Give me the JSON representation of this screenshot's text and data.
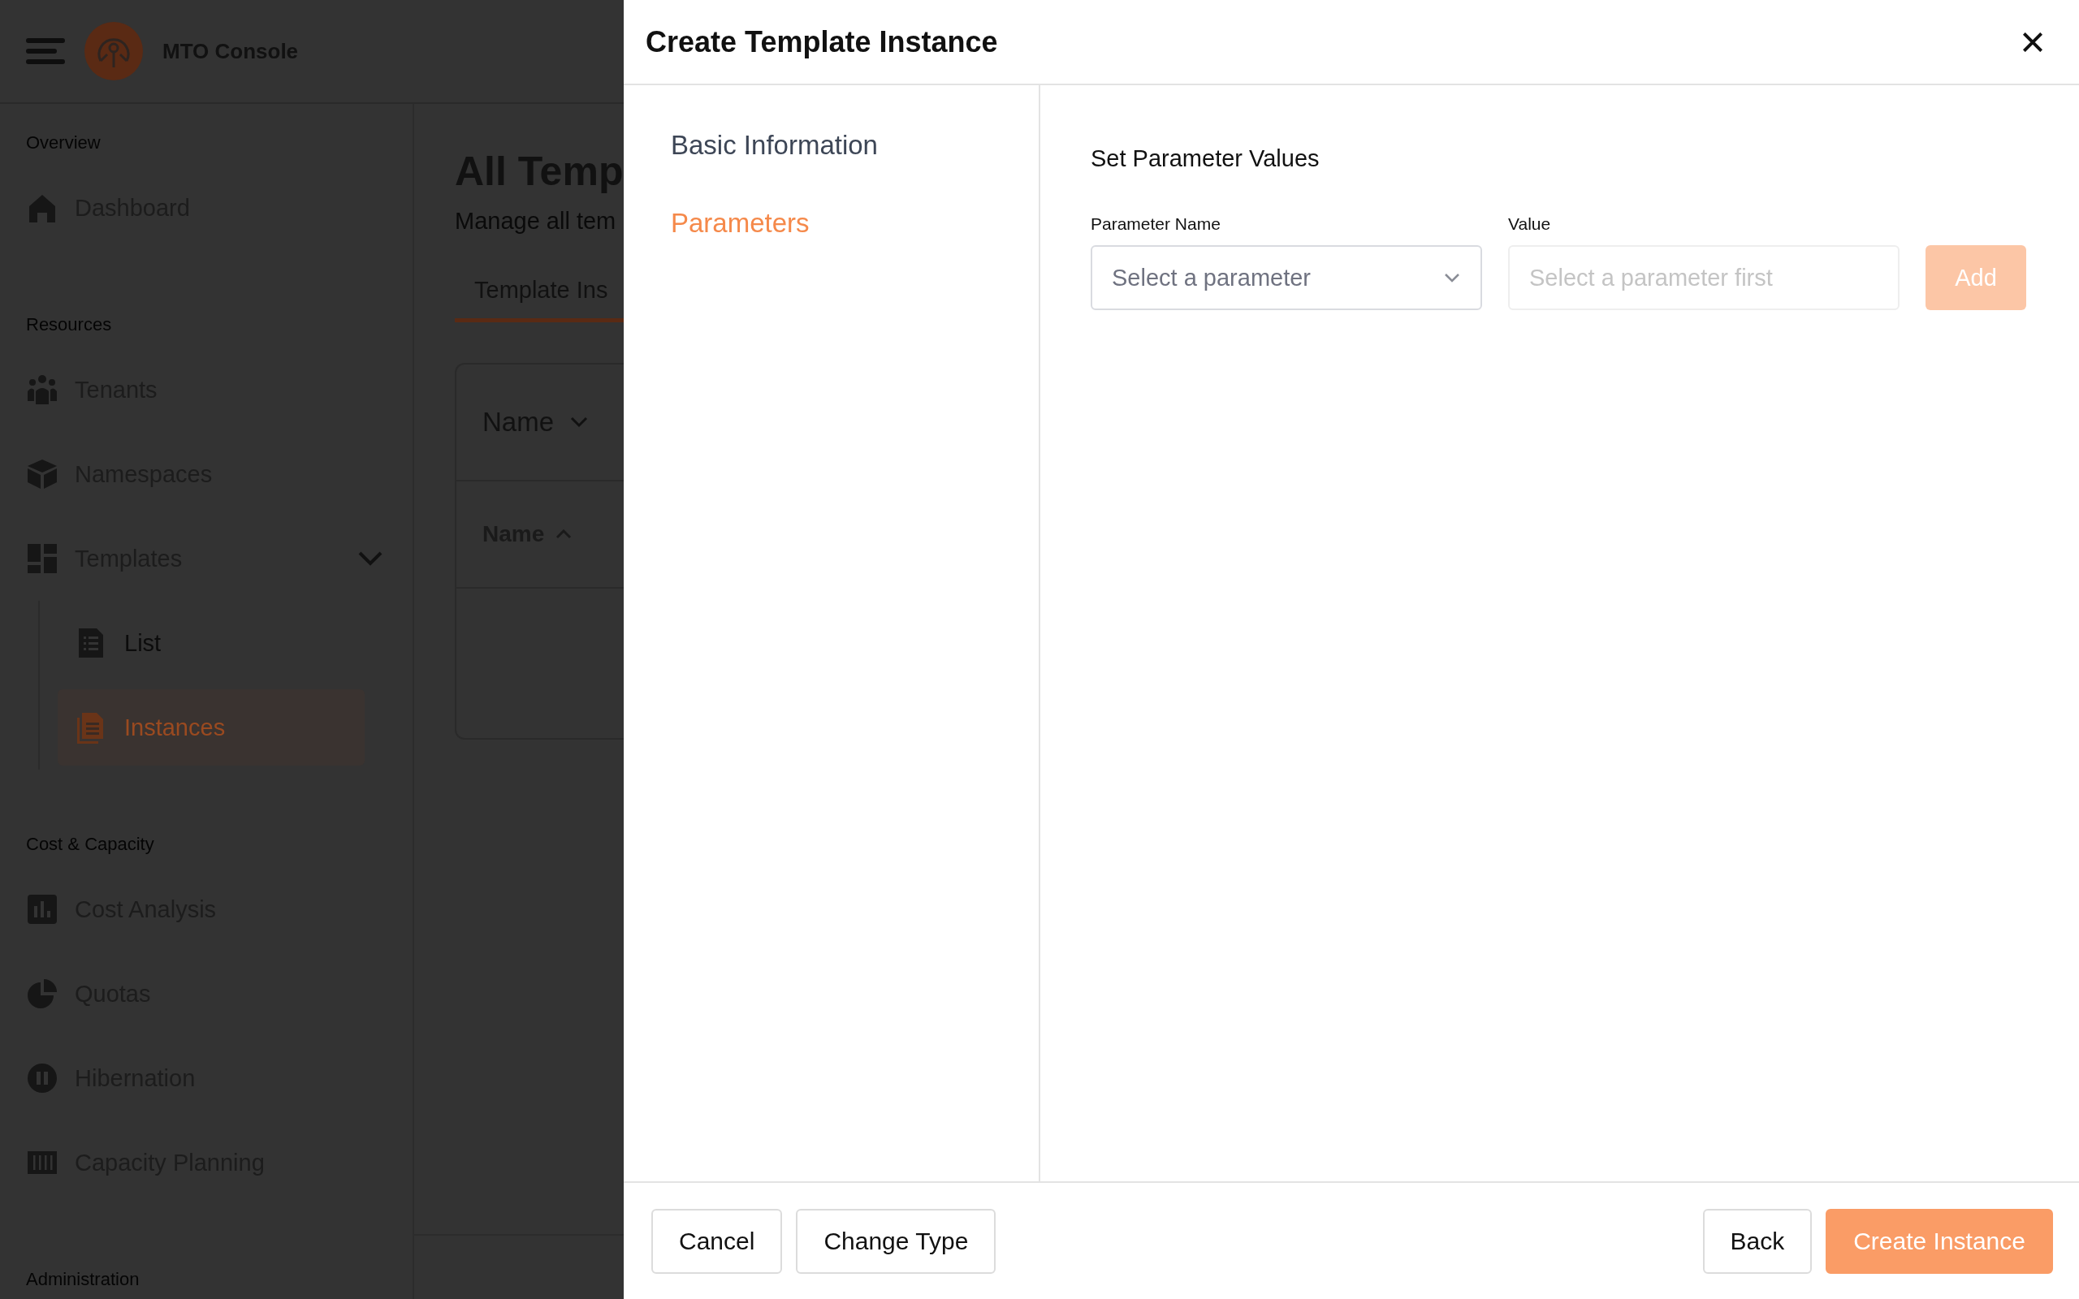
{
  "app": {
    "title": "MTO Console"
  },
  "sidebar": {
    "sections": [
      {
        "label": "Overview",
        "items": [
          {
            "label": "Dashboard",
            "selected": false
          }
        ]
      },
      {
        "label": "Resources",
        "items": [
          {
            "label": "Tenants",
            "selected": false
          },
          {
            "label": "Namespaces",
            "selected": false
          },
          {
            "label": "Templates",
            "selected": false,
            "expanded": true,
            "children": [
              {
                "label": "List",
                "selected": false
              },
              {
                "label": "Instances",
                "selected": true
              }
            ]
          }
        ]
      },
      {
        "label": "Cost & Capacity",
        "items": [
          {
            "label": "Cost Analysis",
            "selected": false
          },
          {
            "label": "Quotas",
            "selected": false
          },
          {
            "label": "Hibernation",
            "selected": false
          },
          {
            "label": "Capacity Planning",
            "selected": false
          }
        ]
      },
      {
        "label": "Administration"
      }
    ]
  },
  "main": {
    "title": "All Temp",
    "subtitle": "Manage all tem",
    "tabs": [
      {
        "label": "Template Ins",
        "selected": true
      }
    ],
    "table": {
      "filter": {
        "label": "Name"
      },
      "columns": [
        {
          "label": "Name",
          "sorted_ascending": true
        }
      ]
    }
  },
  "modal": {
    "title": "Create Template Instance",
    "steps": [
      {
        "label": "Basic Information",
        "selected": false
      },
      {
        "label": "Parameters",
        "selected": true
      }
    ],
    "section_title": "Set Parameter Values",
    "fields": [
      {
        "kind": "select",
        "label": "Parameter Name",
        "placeholder": "Select a parameter",
        "disabled": false
      },
      {
        "kind": "input",
        "label": "Value",
        "placeholder": "Select a parameter first",
        "disabled": true
      }
    ],
    "add_button": {
      "label": "Add",
      "disabled": true
    },
    "footer": {
      "left_buttons": [
        {
          "label": "Cancel",
          "kind": "secondary"
        },
        {
          "label": "Change Type",
          "kind": "secondary"
        }
      ],
      "right_buttons": [
        {
          "label": "Back",
          "kind": "secondary"
        },
        {
          "label": "Create Instance",
          "kind": "primary"
        }
      ]
    }
  }
}
